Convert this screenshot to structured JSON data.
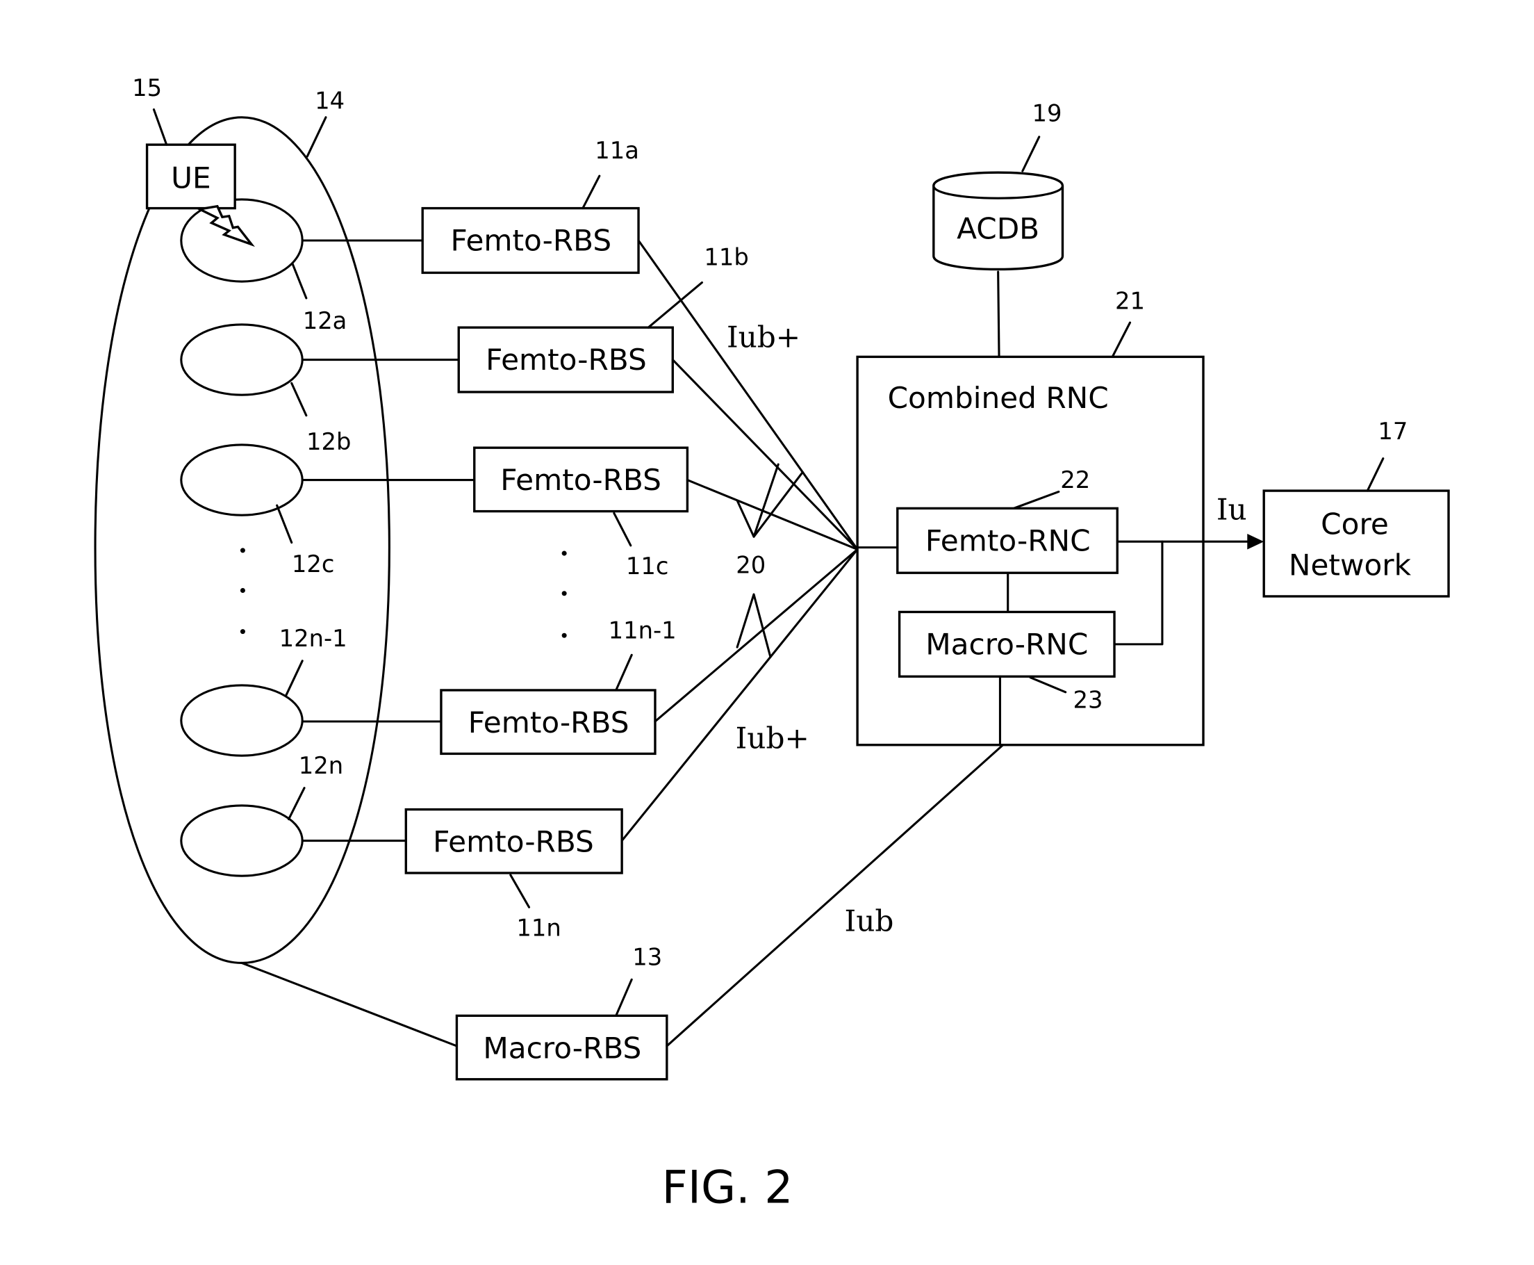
{
  "figure": {
    "caption": "FIG. 2"
  },
  "ue": {
    "label": "UE",
    "ref": "15"
  },
  "cell_area": {
    "ref": "14"
  },
  "femto_cells": [
    {
      "ref": "12a"
    },
    {
      "ref": "12b"
    },
    {
      "ref": "12c"
    },
    {
      "ref": "12n-1"
    },
    {
      "ref": "12n"
    }
  ],
  "femto_rbs": [
    {
      "label": "Femto-RBS",
      "ref": "11a"
    },
    {
      "label": "Femto-RBS",
      "ref": "11b"
    },
    {
      "label": "Femto-RBS",
      "ref": "11c"
    },
    {
      "label": "Femto-RBS",
      "ref": "11n-1"
    },
    {
      "label": "Femto-RBS",
      "ref": "11n"
    }
  ],
  "macro_rbs": {
    "label": "Macro-RBS",
    "ref": "13"
  },
  "interfaces": {
    "iub_plus_upper": "Iub+",
    "iub_plus_lower": "Iub+",
    "iub": "Iub",
    "iu": "Iu",
    "bundle_ref": "20"
  },
  "acdb": {
    "label": "ACDB",
    "ref": "19"
  },
  "combined_rnc": {
    "label": "Combined RNC",
    "ref": "21",
    "femto_rnc": {
      "label": "Femto-RNC",
      "ref": "22"
    },
    "macro_rnc": {
      "label": "Macro-RNC",
      "ref": "23"
    }
  },
  "core_network": {
    "line1": "Core",
    "line2": "Network",
    "ref": "17"
  }
}
